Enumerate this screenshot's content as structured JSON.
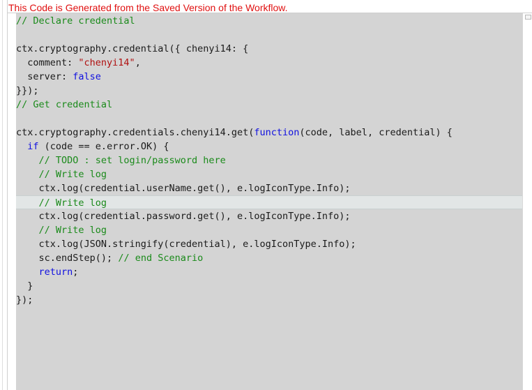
{
  "warning_text": "This Code is Generated from the Saved Version of the Workflow.",
  "colors": {
    "warning": "#e01010",
    "editor_background": "#d4d4d4",
    "comment": "#1a8a1a",
    "string": "#b01010",
    "keyword": "#1010e0",
    "text": "#1a1a1a",
    "active_line": "#e2e6e6"
  },
  "active_line_number": 14,
  "code_lines": [
    [
      [
        "c",
        "// Declare credential"
      ]
    ],
    [],
    [
      [
        "t",
        "ctx.cryptography.credential({ chenyi14: {"
      ]
    ],
    [
      [
        "t",
        "  comment: "
      ],
      [
        "s",
        "\"chenyi14\""
      ],
      [
        "t",
        ","
      ]
    ],
    [
      [
        "t",
        "  server: "
      ],
      [
        "k",
        "false"
      ]
    ],
    [
      [
        "t",
        "}});"
      ]
    ],
    [
      [
        "c",
        "// Get credential"
      ]
    ],
    [],
    [
      [
        "t",
        "ctx.cryptography.credentials.chenyi14.get("
      ],
      [
        "k",
        "function"
      ],
      [
        "t",
        "(code, label, credential) {"
      ]
    ],
    [
      [
        "t",
        "  "
      ],
      [
        "k",
        "if"
      ],
      [
        "t",
        " (code == e.error.OK) {"
      ]
    ],
    [
      [
        "t",
        "    "
      ],
      [
        "c",
        "// TODO : set login/password here"
      ]
    ],
    [
      [
        "t",
        "    "
      ],
      [
        "c",
        "// Write log"
      ]
    ],
    [
      [
        "t",
        "    ctx.log(credential.userName.get(), e.logIconType.Info);"
      ]
    ],
    [
      [
        "t",
        "    "
      ],
      [
        "c",
        "// Write log"
      ]
    ],
    [
      [
        "t",
        "    ctx.log(credential.password.get(), e.logIconType.Info);"
      ]
    ],
    [
      [
        "t",
        "    "
      ],
      [
        "c",
        "// Write log"
      ]
    ],
    [
      [
        "t",
        "    ctx.log(JSON.stringify(credential), e.logIconType.Info);"
      ]
    ],
    [
      [
        "t",
        "    sc.endStep(); "
      ],
      [
        "c",
        "// end Scenario"
      ]
    ],
    [
      [
        "t",
        "    "
      ],
      [
        "k",
        "return"
      ],
      [
        "t",
        ";"
      ]
    ],
    [
      [
        "t",
        "  }"
      ]
    ],
    [
      [
        "t",
        "});"
      ]
    ]
  ]
}
